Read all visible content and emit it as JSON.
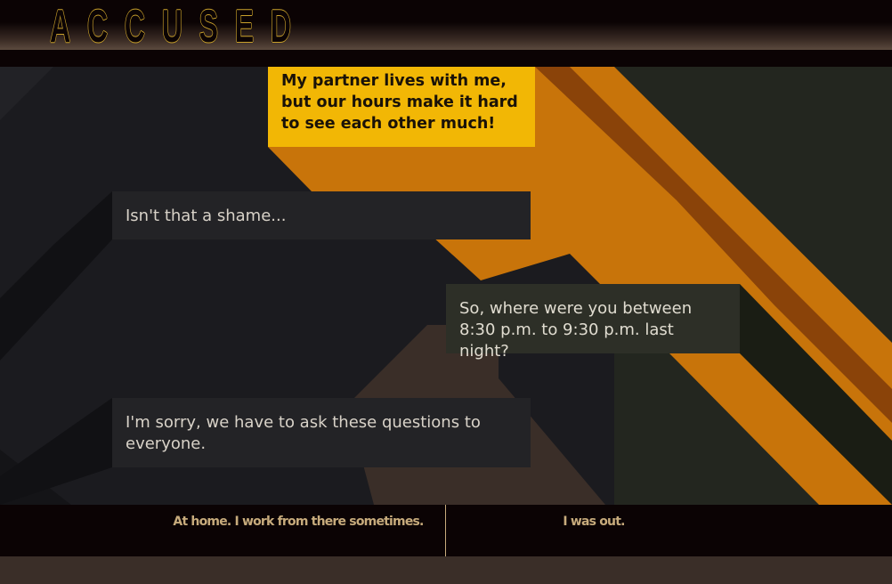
{
  "app": {
    "title": "ACCUSED"
  },
  "dialogue": {
    "line1": "My partner lives with me, but our hours make it hard to see each other much!",
    "line2": "Isn't that a shame...",
    "line3": "So, where were you between 8:30 p.m. to 9:30 p.m. last night?",
    "line4": "I'm sorry, we have to ask these questions to everyone."
  },
  "choices": {
    "option1": "At home. I work from there sometimes.",
    "option2": "I was out."
  },
  "colors": {
    "logo_outline": "#c9a12b",
    "suspect_bubble": "#f2b705",
    "detective_bubble": "#232326",
    "detective_alt_bubble": "#2d2f27",
    "choice_text": "#c7ab7c",
    "stripe_orange": "#c8740a",
    "stripe_brown": "#8a4309"
  }
}
